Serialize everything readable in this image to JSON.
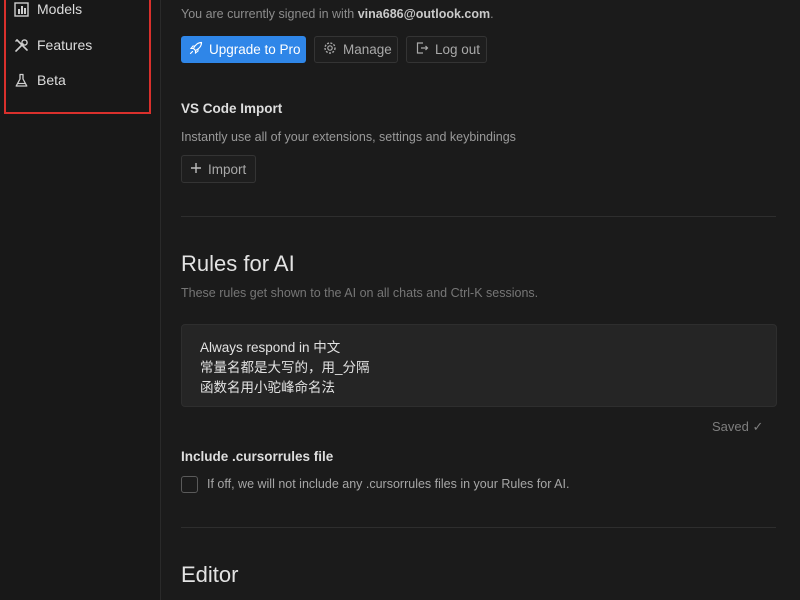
{
  "sidebar": {
    "items": [
      {
        "label": "Models",
        "icon": "bar-chart-icon"
      },
      {
        "label": "Features",
        "icon": "tools-icon"
      },
      {
        "label": "Beta",
        "icon": "flask-icon"
      }
    ]
  },
  "account": {
    "signed_in_prefix": "You are currently signed in with",
    "email": "vina686@outlook.com",
    "upgrade_label": "Upgrade to Pro",
    "manage_label": "Manage",
    "logout_label": "Log out"
  },
  "vscode_import": {
    "title": "VS Code Import",
    "description": "Instantly use all of your extensions, settings and keybindings",
    "import_label": "Import"
  },
  "rules_for_ai": {
    "heading": "Rules for AI",
    "description": "These rules get shown to the AI on all chats and Ctrl-K sessions.",
    "lines": [
      "Always respond in 中文",
      "常量名都是大写的，用_分隔",
      "函数名用小驼峰命名法"
    ],
    "saved_status": "Saved ✓"
  },
  "cursorrules": {
    "title": "Include .cursorrules file",
    "checkbox_label": "If off, we will not include any .cursorrules files in your Rules for AI.",
    "checked": false
  },
  "editor": {
    "heading": "Editor"
  },
  "colors": {
    "background": "#1b1b1b",
    "sidebar": "#181818",
    "accent": "#2f86e8",
    "highlight_border": "#d9302c"
  }
}
